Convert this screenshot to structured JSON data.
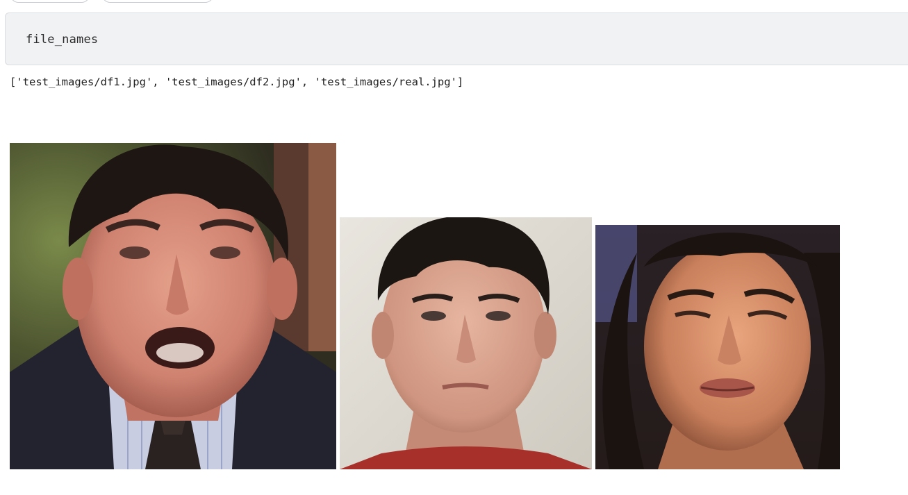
{
  "cell": {
    "code": "file_names"
  },
  "output": {
    "text": "['test_images/df1.jpg', 'test_images/df2.jpg', 'test_images/real.jpg']"
  },
  "images": [
    {
      "subject": "man-face-dark-suit"
    },
    {
      "subject": "man-face-red-shirt"
    },
    {
      "subject": "woman-face-dark-hair"
    }
  ]
}
